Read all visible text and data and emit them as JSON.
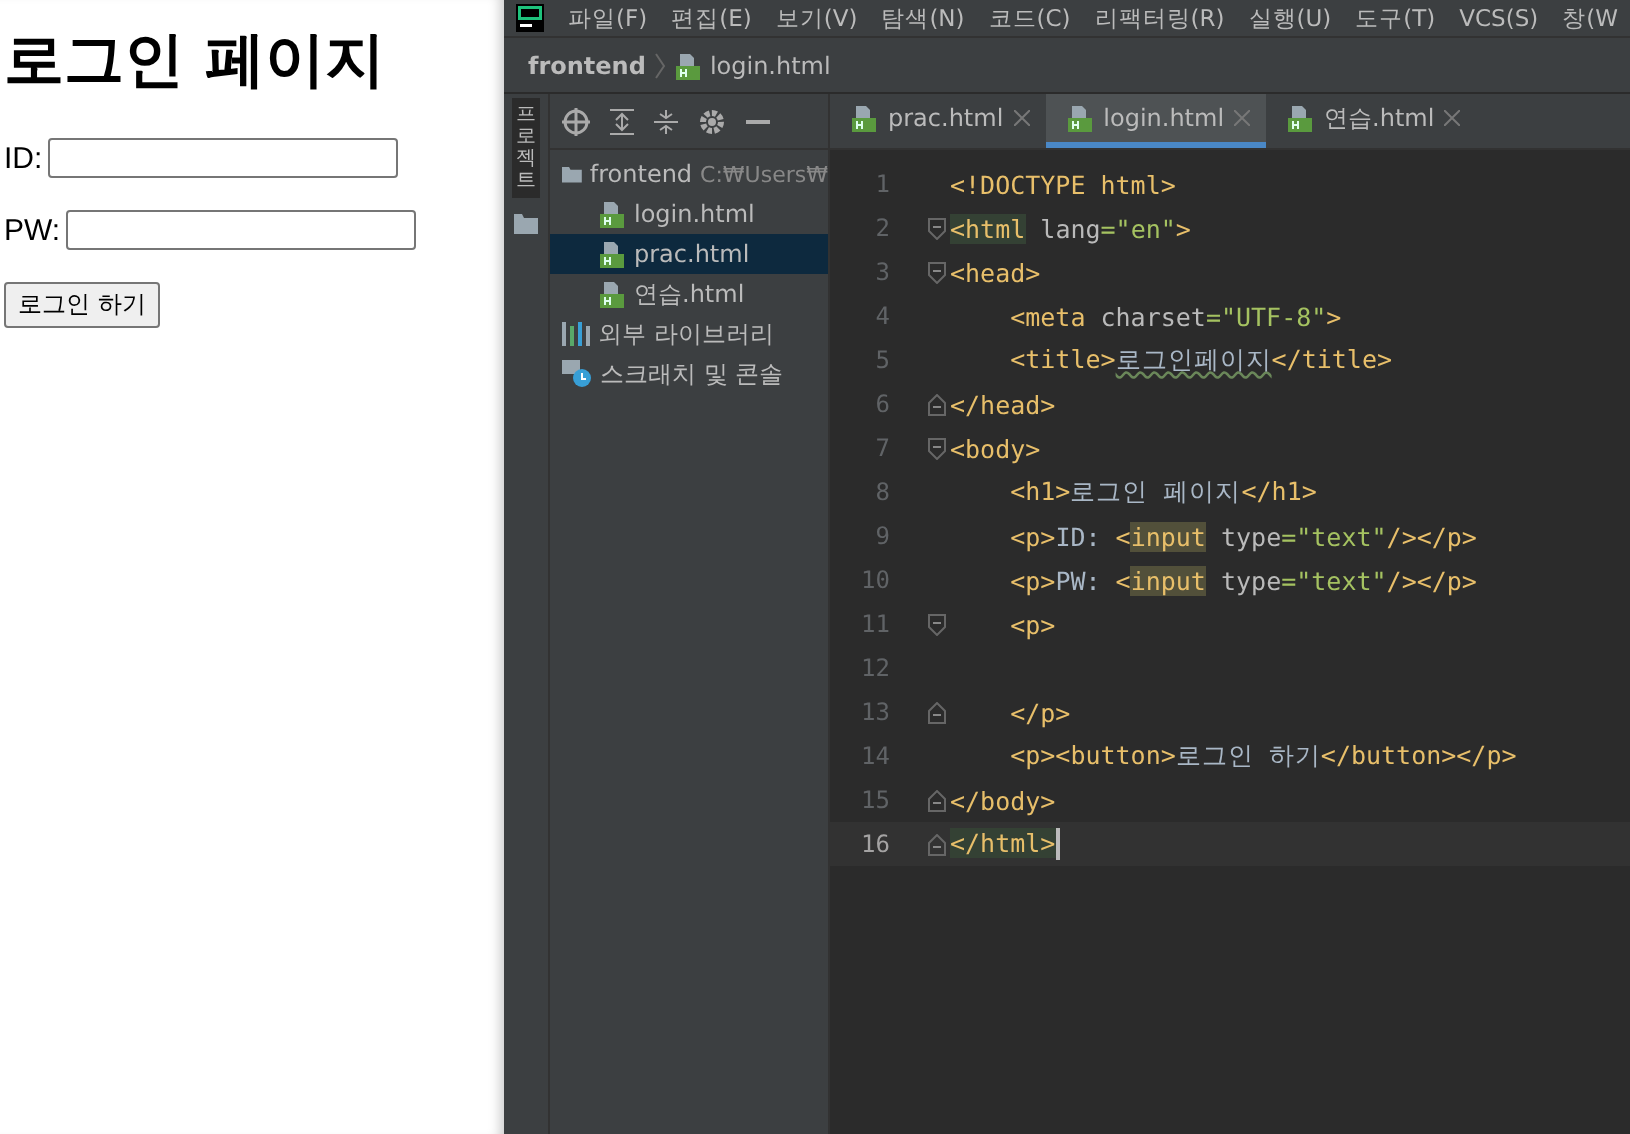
{
  "browser_page": {
    "heading": "로그인 페이지",
    "fields": [
      {
        "label": "ID:"
      },
      {
        "label": "PW:"
      }
    ],
    "button": "로그인 하기"
  },
  "ide": {
    "menu": [
      "파일(F)",
      "편집(E)",
      "보기(V)",
      "탐색(N)",
      "코드(C)",
      "리팩터링(R)",
      "실행(U)",
      "도구(T)",
      "VCS(S)",
      "창(W"
    ],
    "breadcrumb": [
      "frontend",
      "login.html"
    ],
    "tool_strip": {
      "label": "프로젝트"
    },
    "project_tree": [
      {
        "name": "frontend",
        "path": "C:₩Users₩",
        "kind": "folder",
        "selected": false,
        "children": [
          {
            "name": "login.html",
            "kind": "html",
            "selected": false
          },
          {
            "name": "prac.html",
            "kind": "html",
            "selected": true
          },
          {
            "name": "연습.html",
            "kind": "html",
            "selected": false
          }
        ]
      },
      {
        "name": "외부 라이브러리",
        "kind": "library",
        "selected": false
      },
      {
        "name": "스크래치 및 콘솔",
        "kind": "scratch",
        "selected": false
      }
    ],
    "tabs": [
      {
        "label": "prac.html",
        "selected": false
      },
      {
        "label": "login.html",
        "selected": true
      },
      {
        "label": "연습.html",
        "selected": false
      }
    ],
    "lines": [
      {
        "number": "1",
        "fold_start": false,
        "fold_end": false,
        "current": false,
        "segments": [
          {
            "kind": "tag",
            "text": "<!DOCTYPE html>"
          }
        ]
      },
      {
        "number": "2",
        "fold_start": true,
        "fold_end": false,
        "current": false,
        "segments": [
          {
            "kind": "match",
            "text": "<html"
          },
          {
            "kind": "attr",
            "text": " lang"
          },
          {
            "kind": "str",
            "text": "=\"en\""
          },
          {
            "kind": "tag",
            "text": ">"
          }
        ]
      },
      {
        "number": "3",
        "fold_start": true,
        "fold_end": false,
        "current": false,
        "segments": [
          {
            "kind": "tag",
            "text": "<head>"
          }
        ]
      },
      {
        "number": "4",
        "fold_start": false,
        "fold_end": false,
        "current": false,
        "segments": [
          {
            "kind": "tag",
            "text": "    <meta"
          },
          {
            "kind": "attr",
            "text": " charset"
          },
          {
            "kind": "str",
            "text": "=\"UTF-8\""
          },
          {
            "kind": "tag",
            "text": ">"
          }
        ]
      },
      {
        "number": "5",
        "fold_start": false,
        "fold_end": false,
        "current": false,
        "segments": [
          {
            "kind": "tag",
            "text": "    <title>"
          },
          {
            "kind": "typo",
            "text": "로그인페이지"
          },
          {
            "kind": "tag",
            "text": "</title>"
          }
        ]
      },
      {
        "number": "6",
        "fold_start": false,
        "fold_end": true,
        "current": false,
        "segments": [
          {
            "kind": "tag",
            "text": "</head>"
          }
        ]
      },
      {
        "number": "7",
        "fold_start": true,
        "fold_end": false,
        "current": false,
        "segments": [
          {
            "kind": "tag",
            "text": "<body>"
          }
        ]
      },
      {
        "number": "8",
        "fold_start": false,
        "fold_end": false,
        "current": false,
        "segments": [
          {
            "kind": "tag",
            "text": "    <h1>"
          },
          {
            "kind": "text",
            "text": "로그인 페이지"
          },
          {
            "kind": "tag",
            "text": "</h1>"
          }
        ]
      },
      {
        "number": "9",
        "fold_start": false,
        "fold_end": false,
        "current": false,
        "segments": [
          {
            "kind": "tag",
            "text": "    <p>"
          },
          {
            "kind": "text",
            "text": "ID: "
          },
          {
            "kind": "tag",
            "text": "<"
          },
          {
            "kind": "usage",
            "text": "input"
          },
          {
            "kind": "attr",
            "text": " type"
          },
          {
            "kind": "str",
            "text": "=\"text\""
          },
          {
            "kind": "tag",
            "text": "/></p>"
          }
        ]
      },
      {
        "number": "10",
        "fold_start": false,
        "fold_end": false,
        "current": false,
        "segments": [
          {
            "kind": "tag",
            "text": "    <p>"
          },
          {
            "kind": "text",
            "text": "PW: "
          },
          {
            "kind": "tag",
            "text": "<"
          },
          {
            "kind": "usage",
            "text": "input"
          },
          {
            "kind": "attr",
            "text": " type"
          },
          {
            "kind": "str",
            "text": "=\"text\""
          },
          {
            "kind": "tag",
            "text": "/></p>"
          }
        ]
      },
      {
        "number": "11",
        "fold_start": true,
        "fold_end": false,
        "current": false,
        "segments": [
          {
            "kind": "tag",
            "text": "    <p>"
          }
        ]
      },
      {
        "number": "12",
        "fold_start": false,
        "fold_end": false,
        "current": false
      },
      {
        "number": "13",
        "fold_start": false,
        "fold_end": true,
        "current": false,
        "segments": [
          {
            "kind": "tag",
            "text": "    </p>"
          }
        ]
      },
      {
        "number": "14",
        "fold_start": false,
        "fold_end": false,
        "current": false,
        "segments": [
          {
            "kind": "tag",
            "text": "    <p><button>"
          },
          {
            "kind": "text",
            "text": "로그인 하기"
          },
          {
            "kind": "tag",
            "text": "</button></p>"
          }
        ]
      },
      {
        "number": "15",
        "fold_start": false,
        "fold_end": true,
        "current": false,
        "segments": [
          {
            "kind": "tag",
            "text": "</body>"
          }
        ]
      },
      {
        "number": "16",
        "fold_start": false,
        "fold_end": true,
        "current": true,
        "segments": [
          {
            "kind": "match",
            "text": "</html>"
          }
        ]
      }
    ]
  }
}
